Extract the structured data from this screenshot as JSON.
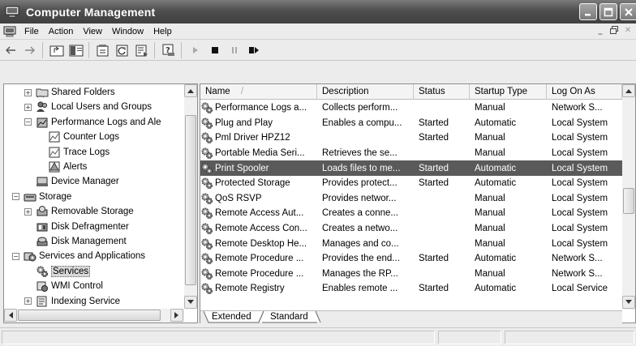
{
  "window": {
    "title": "Computer Management"
  },
  "menu": {
    "items": [
      "File",
      "Action",
      "View",
      "Window",
      "Help"
    ]
  },
  "tree": {
    "items": [
      {
        "label": "Shared Folders",
        "icon": "shared-folder-icon",
        "indent": 1,
        "expander": "+"
      },
      {
        "label": "Local Users and Groups",
        "icon": "users-icon",
        "indent": 1,
        "expander": "+"
      },
      {
        "label": "Performance Logs and Ale",
        "icon": "performance-logs-icon",
        "indent": 1,
        "expander": "−"
      },
      {
        "label": "Counter Logs",
        "icon": "log-icon",
        "indent": 2,
        "expander": ""
      },
      {
        "label": "Trace Logs",
        "icon": "log-icon",
        "indent": 2,
        "expander": ""
      },
      {
        "label": "Alerts",
        "icon": "alert-log-icon",
        "indent": 2,
        "expander": ""
      },
      {
        "label": "Device Manager",
        "icon": "device-manager-icon",
        "indent": 1,
        "expander": ""
      },
      {
        "label": "Storage",
        "icon": "storage-icon",
        "indent": 0,
        "expander": "−"
      },
      {
        "label": "Removable Storage",
        "icon": "removable-storage-icon",
        "indent": 1,
        "expander": "+"
      },
      {
        "label": "Disk Defragmenter",
        "icon": "defrag-icon",
        "indent": 1,
        "expander": ""
      },
      {
        "label": "Disk Management",
        "icon": "disk-management-icon",
        "indent": 1,
        "expander": ""
      },
      {
        "label": "Services and Applications",
        "icon": "services-apps-icon",
        "indent": 0,
        "expander": "−"
      },
      {
        "label": "Services",
        "icon": "services-gear-icon",
        "indent": 1,
        "expander": "",
        "selected": true
      },
      {
        "label": "WMI Control",
        "icon": "wmi-icon",
        "indent": 1,
        "expander": ""
      },
      {
        "label": "Indexing Service",
        "icon": "indexing-icon",
        "indent": 1,
        "expander": "+"
      }
    ]
  },
  "list": {
    "columns": [
      "Name",
      "Description",
      "Status",
      "Startup Type",
      "Log On As"
    ],
    "sort_indicator": "/",
    "rows": [
      [
        "Performance Logs a...",
        "Collects perform...",
        "",
        "Manual",
        "Network S..."
      ],
      [
        "Plug and Play",
        "Enables a compu...",
        "Started",
        "Automatic",
        "Local System"
      ],
      [
        "Pml Driver HPZ12",
        "",
        "Started",
        "Manual",
        "Local System"
      ],
      [
        "Portable Media Seri...",
        "Retrieves the se...",
        "",
        "Manual",
        "Local System"
      ],
      [
        "Print Spooler",
        "Loads files to me...",
        "Started",
        "Automatic",
        "Local System"
      ],
      [
        "Protected Storage",
        "Provides protect...",
        "Started",
        "Automatic",
        "Local System"
      ],
      [
        "QoS RSVP",
        "Provides networ...",
        "",
        "Manual",
        "Local System"
      ],
      [
        "Remote Access Aut...",
        "Creates a conne...",
        "",
        "Manual",
        "Local System"
      ],
      [
        "Remote Access Con...",
        "Creates a netwo...",
        "",
        "Manual",
        "Local System"
      ],
      [
        "Remote Desktop He...",
        "Manages and co...",
        "",
        "Manual",
        "Local System"
      ],
      [
        "Remote Procedure ...",
        "Provides the end...",
        "Started",
        "Automatic",
        "Network S..."
      ],
      [
        "Remote Procedure ...",
        "Manages the RP...",
        "",
        "Manual",
        "Network S..."
      ],
      [
        "Remote Registry",
        "Enables remote ...",
        "Started",
        "Automatic",
        "Local Service"
      ]
    ],
    "selected_row": 4,
    "tabs": [
      "Extended",
      "Standard"
    ],
    "active_tab": "Standard"
  },
  "colors": {
    "title_bar": "#4e4e4e",
    "selection": "#5a5a5a"
  }
}
